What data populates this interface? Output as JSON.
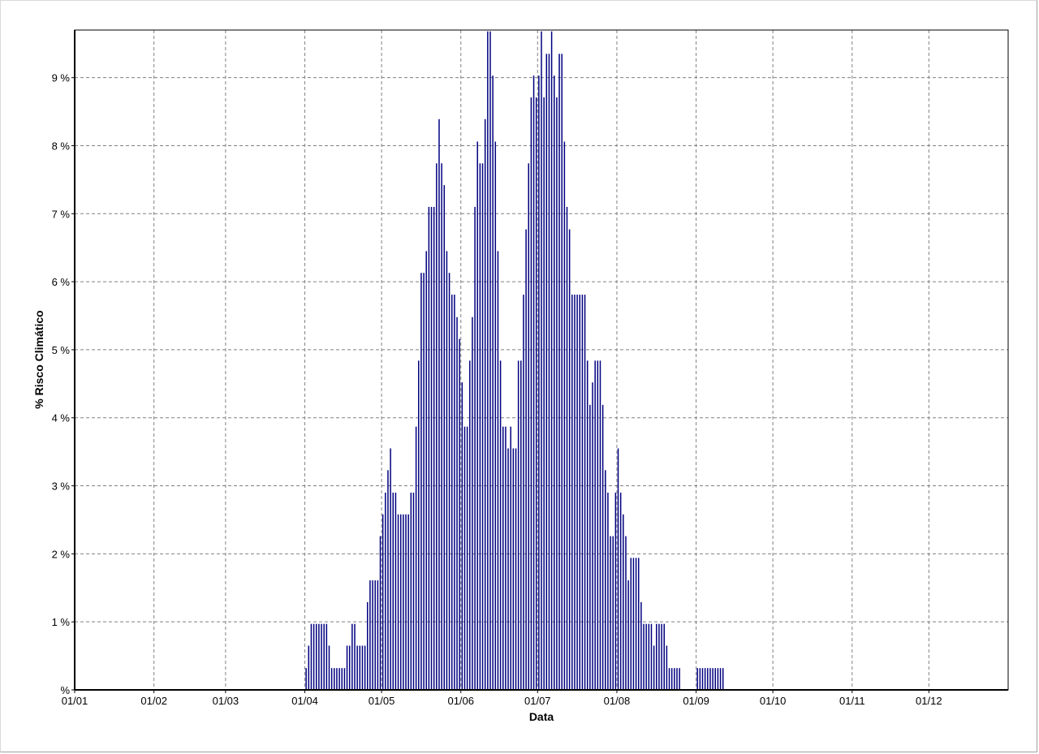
{
  "chart_data": {
    "type": "bar",
    "title": "",
    "xlabel": "Data",
    "ylabel": "% Risco Climático",
    "x_axis": {
      "type": "date",
      "ticks": [
        "01/01",
        "01/02",
        "01/03",
        "01/04",
        "01/05",
        "01/06",
        "01/07",
        "01/08",
        "01/09",
        "01/10",
        "01/11",
        "01/12"
      ],
      "range": [
        "01/01",
        "31/12"
      ]
    },
    "y_axis": {
      "ticks": [
        "%",
        "1 %",
        "2 %",
        "3 %",
        "4 %",
        "5 %",
        "6 %",
        "7 %",
        "8 %",
        "9 %"
      ],
      "range": [
        0,
        9.7
      ],
      "unit": "%"
    },
    "grid": true,
    "bar_color": "#000080",
    "grid_color": "#808080",
    "series": [
      {
        "values": [
          {
            "date": "01/04",
            "value": 0.32
          },
          {
            "date": "02/04",
            "value": 0.65
          },
          {
            "date": "03/04",
            "value": 0.97
          },
          {
            "date": "04/04",
            "value": 0.97
          },
          {
            "date": "05/04",
            "value": 0.97
          },
          {
            "date": "06/04",
            "value": 0.97
          },
          {
            "date": "07/04",
            "value": 0.97
          },
          {
            "date": "08/04",
            "value": 0.97
          },
          {
            "date": "09/04",
            "value": 0.97
          },
          {
            "date": "10/04",
            "value": 0.65
          },
          {
            "date": "11/04",
            "value": 0.32
          },
          {
            "date": "12/04",
            "value": 0.32
          },
          {
            "date": "13/04",
            "value": 0.32
          },
          {
            "date": "14/04",
            "value": 0.32
          },
          {
            "date": "15/04",
            "value": 0.32
          },
          {
            "date": "16/04",
            "value": 0.32
          },
          {
            "date": "17/04",
            "value": 0.65
          },
          {
            "date": "18/04",
            "value": 0.65
          },
          {
            "date": "19/04",
            "value": 0.97
          },
          {
            "date": "20/04",
            "value": 0.97
          },
          {
            "date": "21/04",
            "value": 0.65
          },
          {
            "date": "22/04",
            "value": 0.65
          },
          {
            "date": "23/04",
            "value": 0.65
          },
          {
            "date": "24/04",
            "value": 0.65
          },
          {
            "date": "25/04",
            "value": 1.29
          },
          {
            "date": "26/04",
            "value": 1.61
          },
          {
            "date": "27/04",
            "value": 1.61
          },
          {
            "date": "28/04",
            "value": 1.61
          },
          {
            "date": "29/04",
            "value": 1.61
          },
          {
            "date": "30/04",
            "value": 2.26
          },
          {
            "date": "01/05",
            "value": 2.58
          },
          {
            "date": "02/05",
            "value": 2.9
          },
          {
            "date": "03/05",
            "value": 3.23
          },
          {
            "date": "04/05",
            "value": 3.55
          },
          {
            "date": "05/05",
            "value": 2.9
          },
          {
            "date": "06/05",
            "value": 2.9
          },
          {
            "date": "07/05",
            "value": 2.58
          },
          {
            "date": "08/05",
            "value": 2.58
          },
          {
            "date": "09/05",
            "value": 2.58
          },
          {
            "date": "10/05",
            "value": 2.58
          },
          {
            "date": "11/05",
            "value": 2.58
          },
          {
            "date": "12/05",
            "value": 2.9
          },
          {
            "date": "13/05",
            "value": 2.9
          },
          {
            "date": "14/05",
            "value": 3.87
          },
          {
            "date": "15/05",
            "value": 4.84
          },
          {
            "date": "16/05",
            "value": 6.13
          },
          {
            "date": "17/05",
            "value": 6.13
          },
          {
            "date": "18/05",
            "value": 6.45
          },
          {
            "date": "19/05",
            "value": 7.1
          },
          {
            "date": "20/05",
            "value": 7.1
          },
          {
            "date": "21/05",
            "value": 7.1
          },
          {
            "date": "22/05",
            "value": 7.74
          },
          {
            "date": "23/05",
            "value": 8.39
          },
          {
            "date": "24/05",
            "value": 7.74
          },
          {
            "date": "25/05",
            "value": 7.42
          },
          {
            "date": "26/05",
            "value": 6.45
          },
          {
            "date": "27/05",
            "value": 6.13
          },
          {
            "date": "28/05",
            "value": 5.81
          },
          {
            "date": "29/05",
            "value": 5.81
          },
          {
            "date": "30/05",
            "value": 5.48
          },
          {
            "date": "31/05",
            "value": 5.16
          },
          {
            "date": "01/06",
            "value": 4.52
          },
          {
            "date": "02/06",
            "value": 3.87
          },
          {
            "date": "03/06",
            "value": 3.87
          },
          {
            "date": "04/06",
            "value": 4.84
          },
          {
            "date": "05/06",
            "value": 5.48
          },
          {
            "date": "06/06",
            "value": 7.1
          },
          {
            "date": "07/06",
            "value": 8.06
          },
          {
            "date": "08/06",
            "value": 7.74
          },
          {
            "date": "09/06",
            "value": 7.74
          },
          {
            "date": "10/06",
            "value": 8.39
          },
          {
            "date": "11/06",
            "value": 9.68
          },
          {
            "date": "12/06",
            "value": 9.68
          },
          {
            "date": "13/06",
            "value": 9.03
          },
          {
            "date": "14/06",
            "value": 8.06
          },
          {
            "date": "15/06",
            "value": 6.45
          },
          {
            "date": "16/06",
            "value": 4.84
          },
          {
            "date": "17/06",
            "value": 3.87
          },
          {
            "date": "18/06",
            "value": 3.87
          },
          {
            "date": "19/06",
            "value": 3.55
          },
          {
            "date": "20/06",
            "value": 3.87
          },
          {
            "date": "21/06",
            "value": 3.55
          },
          {
            "date": "22/06",
            "value": 3.55
          },
          {
            "date": "23/06",
            "value": 4.84
          },
          {
            "date": "24/06",
            "value": 4.84
          },
          {
            "date": "25/06",
            "value": 5.81
          },
          {
            "date": "26/06",
            "value": 6.77
          },
          {
            "date": "27/06",
            "value": 7.74
          },
          {
            "date": "28/06",
            "value": 8.71
          },
          {
            "date": "29/06",
            "value": 9.03
          },
          {
            "date": "30/06",
            "value": 8.71
          },
          {
            "date": "01/07",
            "value": 9.03
          },
          {
            "date": "02/07",
            "value": 9.68
          },
          {
            "date": "03/07",
            "value": 8.71
          },
          {
            "date": "04/07",
            "value": 9.35
          },
          {
            "date": "05/07",
            "value": 9.35
          },
          {
            "date": "06/07",
            "value": 9.68
          },
          {
            "date": "07/07",
            "value": 9.03
          },
          {
            "date": "08/07",
            "value": 8.71
          },
          {
            "date": "09/07",
            "value": 9.35
          },
          {
            "date": "10/07",
            "value": 9.35
          },
          {
            "date": "11/07",
            "value": 8.06
          },
          {
            "date": "12/07",
            "value": 7.1
          },
          {
            "date": "13/07",
            "value": 6.77
          },
          {
            "date": "14/07",
            "value": 5.81
          },
          {
            "date": "15/07",
            "value": 5.81
          },
          {
            "date": "16/07",
            "value": 5.81
          },
          {
            "date": "17/07",
            "value": 5.81
          },
          {
            "date": "18/07",
            "value": 5.81
          },
          {
            "date": "19/07",
            "value": 5.81
          },
          {
            "date": "20/07",
            "value": 4.84
          },
          {
            "date": "21/07",
            "value": 4.19
          },
          {
            "date": "22/07",
            "value": 4.52
          },
          {
            "date": "23/07",
            "value": 4.84
          },
          {
            "date": "24/07",
            "value": 4.84
          },
          {
            "date": "25/07",
            "value": 4.84
          },
          {
            "date": "26/07",
            "value": 4.19
          },
          {
            "date": "27/07",
            "value": 3.23
          },
          {
            "date": "28/07",
            "value": 2.9
          },
          {
            "date": "29/07",
            "value": 2.26
          },
          {
            "date": "30/07",
            "value": 2.26
          },
          {
            "date": "31/07",
            "value": 2.9
          },
          {
            "date": "01/08",
            "value": 3.55
          },
          {
            "date": "02/08",
            "value": 2.9
          },
          {
            "date": "03/08",
            "value": 2.58
          },
          {
            "date": "04/08",
            "value": 2.26
          },
          {
            "date": "05/08",
            "value": 1.61
          },
          {
            "date": "06/08",
            "value": 1.94
          },
          {
            "date": "07/08",
            "value": 1.94
          },
          {
            "date": "08/08",
            "value": 1.94
          },
          {
            "date": "09/08",
            "value": 1.94
          },
          {
            "date": "10/08",
            "value": 1.29
          },
          {
            "date": "11/08",
            "value": 0.97
          },
          {
            "date": "12/08",
            "value": 0.97
          },
          {
            "date": "13/08",
            "value": 0.97
          },
          {
            "date": "14/08",
            "value": 0.97
          },
          {
            "date": "15/08",
            "value": 0.65
          },
          {
            "date": "16/08",
            "value": 0.97
          },
          {
            "date": "17/08",
            "value": 0.97
          },
          {
            "date": "18/08",
            "value": 0.97
          },
          {
            "date": "19/08",
            "value": 0.97
          },
          {
            "date": "20/08",
            "value": 0.65
          },
          {
            "date": "21/08",
            "value": 0.32
          },
          {
            "date": "22/08",
            "value": 0.32
          },
          {
            "date": "23/08",
            "value": 0.32
          },
          {
            "date": "24/08",
            "value": 0.32
          },
          {
            "date": "25/08",
            "value": 0.32
          },
          {
            "date": "01/09",
            "value": 0.32
          },
          {
            "date": "02/09",
            "value": 0.32
          },
          {
            "date": "03/09",
            "value": 0.32
          },
          {
            "date": "04/09",
            "value": 0.32
          },
          {
            "date": "05/09",
            "value": 0.32
          },
          {
            "date": "06/09",
            "value": 0.32
          },
          {
            "date": "07/09",
            "value": 0.32
          },
          {
            "date": "08/09",
            "value": 0.32
          },
          {
            "date": "09/09",
            "value": 0.32
          },
          {
            "date": "10/09",
            "value": 0.32
          },
          {
            "date": "11/09",
            "value": 0.32
          }
        ]
      }
    ]
  }
}
